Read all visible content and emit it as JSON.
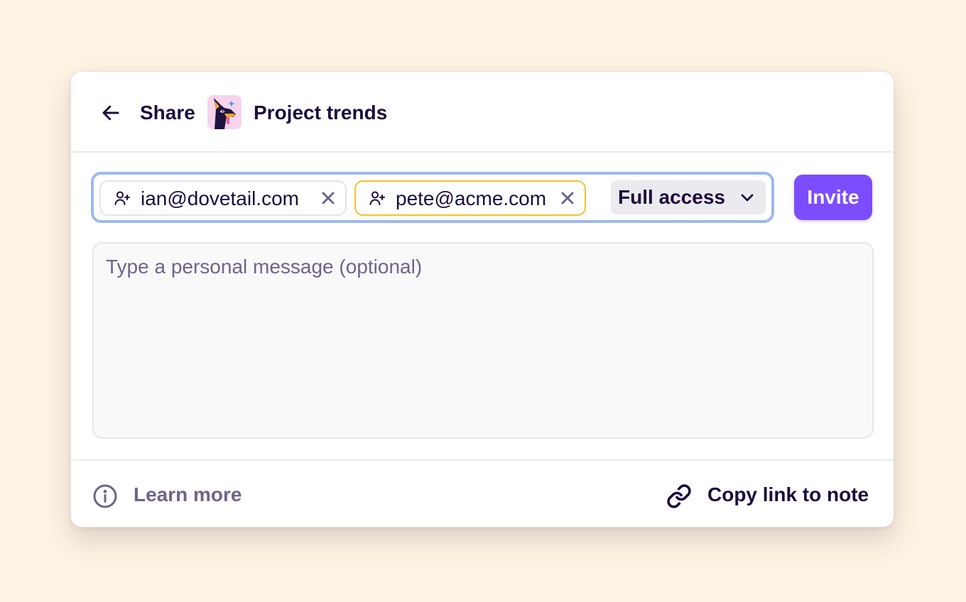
{
  "header": {
    "back_icon": "arrow-left-icon",
    "share_label": "Share",
    "project_avatar_icon": "jackal-mascot-avatar",
    "project_name": "Project trends"
  },
  "invite": {
    "chips": [
      {
        "icon": "user-plus-icon",
        "email": "ian@dovetail.com",
        "remove_icon": "close-icon",
        "border_color": "#e4e3ea"
      },
      {
        "icon": "user-plus-icon",
        "email": "pete@acme.com",
        "remove_icon": "close-icon",
        "border_color": "#f6c02d"
      }
    ],
    "access_level": "Full access",
    "access_chevron_icon": "chevron-down-icon",
    "invite_button_label": "Invite",
    "focus_border_color": "#9cb8f2"
  },
  "message": {
    "value": "",
    "placeholder": "Type a personal message (optional)"
  },
  "footer": {
    "learn_more_icon": "info-icon",
    "learn_more_label": "Learn more",
    "copy_link_icon": "link-icon",
    "copy_link_label": "Copy link to note"
  },
  "colors": {
    "page_background": "#fdf3e3",
    "text_primary": "#1c0d3d",
    "text_muted": "#6f6487",
    "accent": "#7c4dff",
    "avatar_background": "#f7d3ec"
  }
}
